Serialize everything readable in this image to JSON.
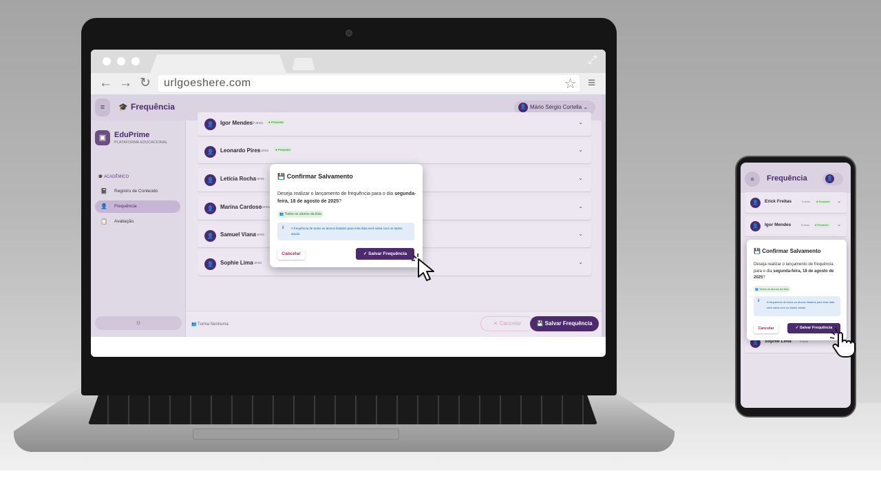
{
  "browser": {
    "url": "urlgoeshere.com"
  },
  "app": {
    "title": "Frequência",
    "user_name": "Mário Sérgio Cortella",
    "user_initial": "👤",
    "brand_name": "EduPrime",
    "brand_tagline": "PLATAFORMA EDUCACIONAL",
    "section": "ACADÊMICO",
    "menu": [
      {
        "label": "Registro de Conteúdo",
        "icon": "📓"
      },
      {
        "label": "Frequência",
        "icon": "👤"
      },
      {
        "label": "Avaliação",
        "icon": "📋"
      }
    ],
    "gear_icon": "☼",
    "students": [
      {
        "name": "Igor Mendes",
        "age": "9 anos",
        "status": "Presente"
      },
      {
        "name": "Leonardo Pires",
        "age": "9 anos",
        "status": "Presente"
      },
      {
        "name": "Letícia Rocha",
        "age": "9 anos",
        "status": ""
      },
      {
        "name": "Marina Cardoso",
        "age": "8 anos",
        "status": ""
      },
      {
        "name": "Samuel Viana",
        "age": "9 anos",
        "status": ""
      },
      {
        "name": "Sophie Lima",
        "age": "8 anos",
        "status": ""
      }
    ],
    "footer": {
      "turma": "Turma Nenhuma",
      "cancel": "Cancelar",
      "save": "Salvar Frequência"
    }
  },
  "dialog": {
    "title": "Confirmar Salvamento",
    "text_pre": "Deseja realizar o lançamento de frequência para o dia ",
    "date": "segunda-feira, 18 de agosto de 2025",
    "text_post": "?",
    "chip": "Todos os alunos da lista",
    "info": "A frequência de todos os alunos listados para esta data será salva com os dados atuais.",
    "cancel": "Cancelar",
    "save": "Salvar Frequência"
  },
  "phone": {
    "title": "Frequência",
    "students": [
      {
        "name": "Erick Freitas",
        "age": "9 anos",
        "status": "Presente"
      },
      {
        "name": "Igor Mendes",
        "age": "9 anos",
        "status": "Presente"
      },
      {
        "name": "Sophie Lima",
        "age": "9 anos",
        "status": ""
      }
    ]
  },
  "colors": {
    "brand": "#4b2a6e",
    "present": "#2f7a37",
    "info": "#1f5fa6",
    "cancel": "#b0264c"
  }
}
